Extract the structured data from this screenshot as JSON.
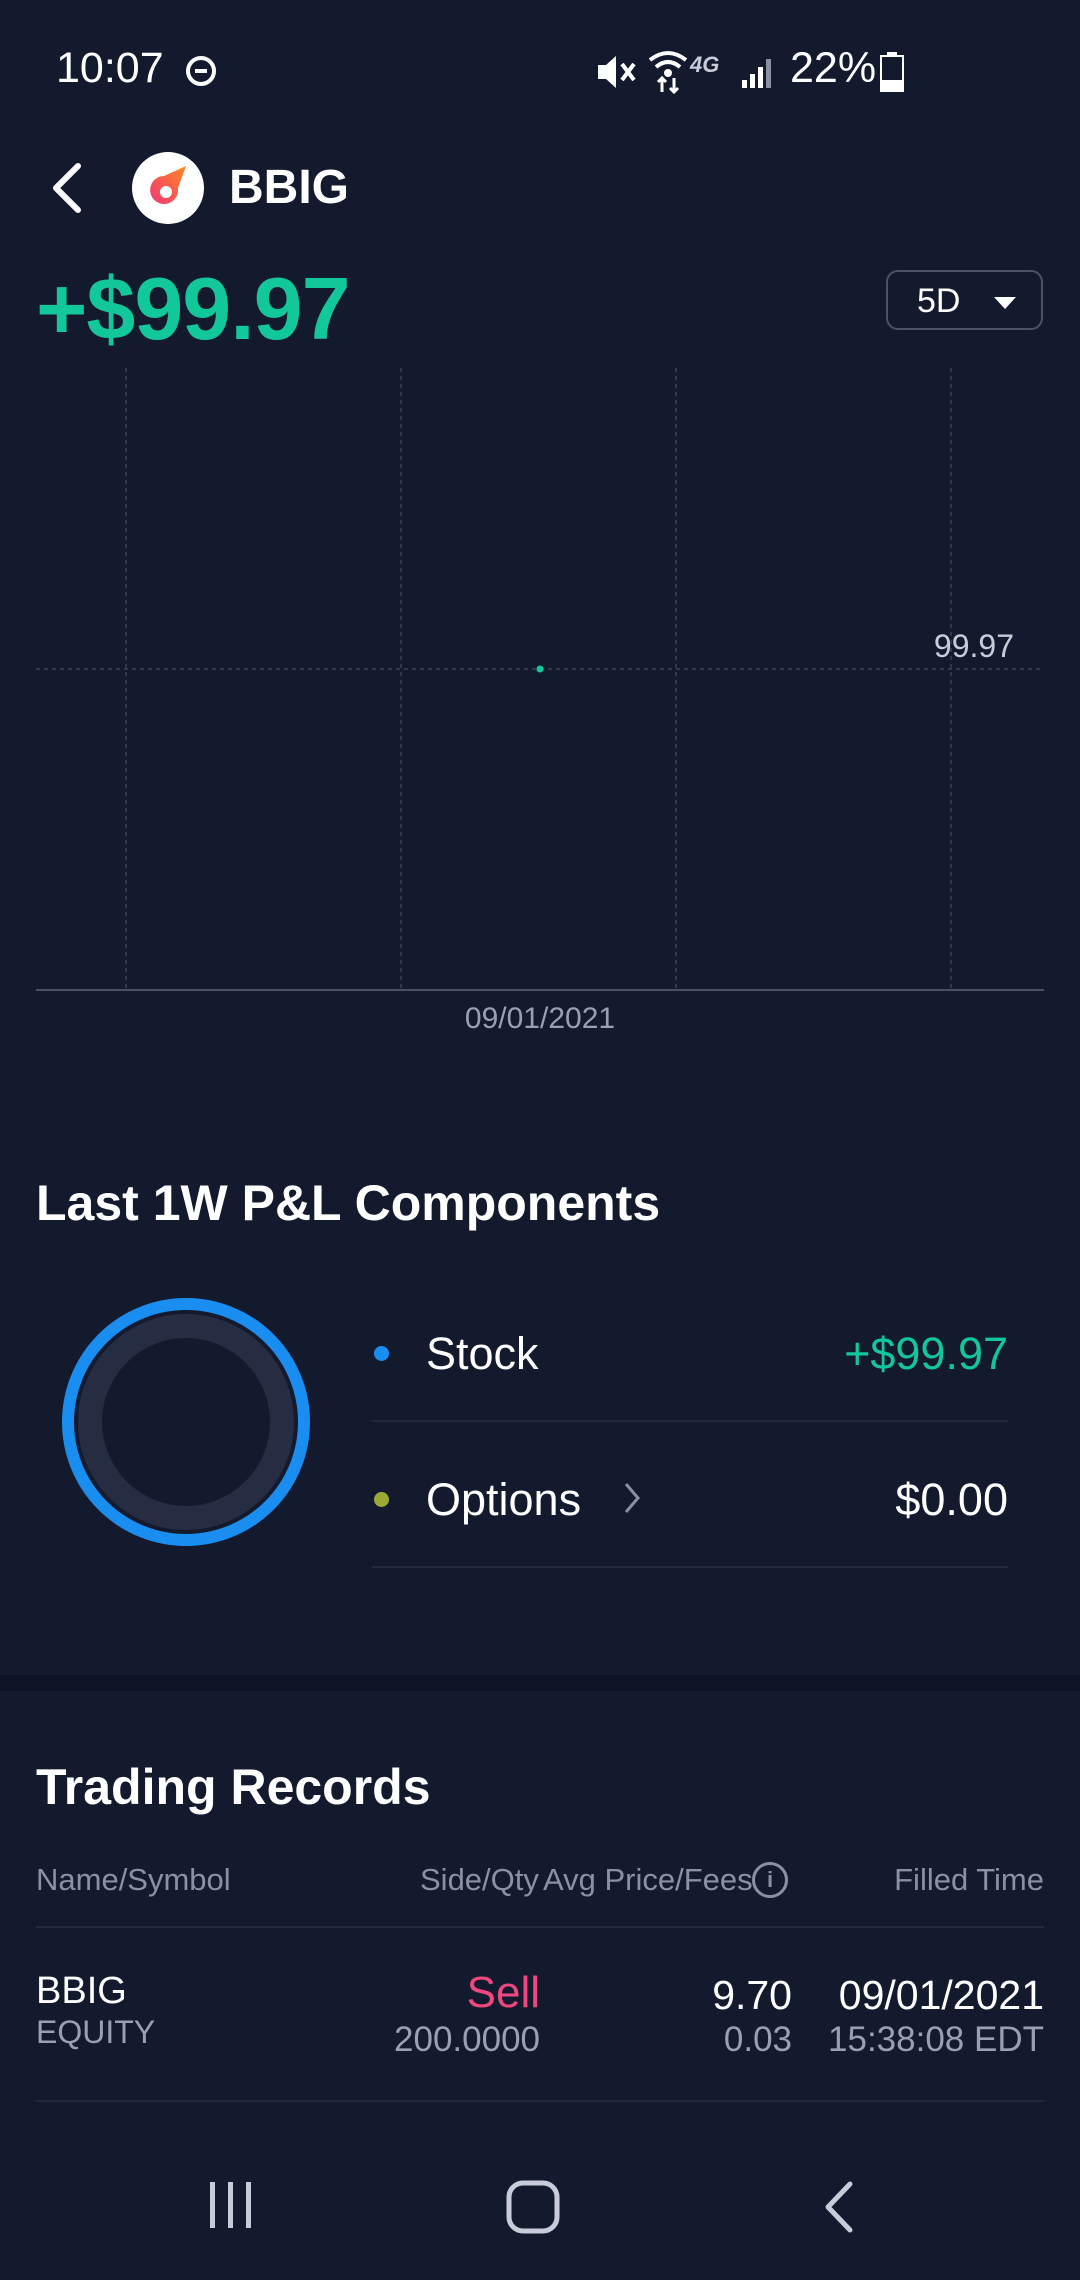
{
  "status_bar": {
    "time": "10:07",
    "battery": "22%",
    "network": "4G"
  },
  "header": {
    "symbol": "BBIG",
    "logo_icon": "rocket-logo-icon"
  },
  "summary": {
    "pnl": "+$99.97",
    "range": "5D"
  },
  "chart_data": {
    "type": "line",
    "x": [
      "09/01/2021"
    ],
    "series": [
      {
        "values": [
          99.97
        ]
      }
    ],
    "reference_line": 99.97,
    "reference_label": "99.97",
    "x_tick_labels": [
      "09/01/2021"
    ],
    "grid": true,
    "colors": {
      "line": "#12c79a",
      "grid": "#3a4158"
    }
  },
  "components": {
    "title": "Last 1W P&L Components",
    "items": [
      {
        "label": "Stock",
        "value": "+$99.97",
        "dot_color": "#1a8ef0",
        "value_color": "#12c79a",
        "has_chevron": false
      },
      {
        "label": "Options",
        "value": "$0.00",
        "dot_color": "#9aab35",
        "value_color": "#ffffff",
        "has_chevron": true
      }
    ],
    "ring_share": {
      "stock": 1.0,
      "options": 0.0
    }
  },
  "records": {
    "title": "Trading Records",
    "columns": [
      "Name/Symbol",
      "Side/Qty",
      "Avg Price/Fees",
      "Filled Time"
    ],
    "rows": [
      {
        "symbol": "BBIG",
        "type": "EQUITY",
        "side": "Sell",
        "qty": "200.0000",
        "avg_price": "9.70",
        "fees": "0.03",
        "date": "09/01/2021",
        "time": "15:38:08 EDT"
      }
    ]
  },
  "colors": {
    "background": "#141a2e",
    "positive": "#12c79a",
    "sell": "#f0487e",
    "stock_blue": "#1a8ef0"
  }
}
